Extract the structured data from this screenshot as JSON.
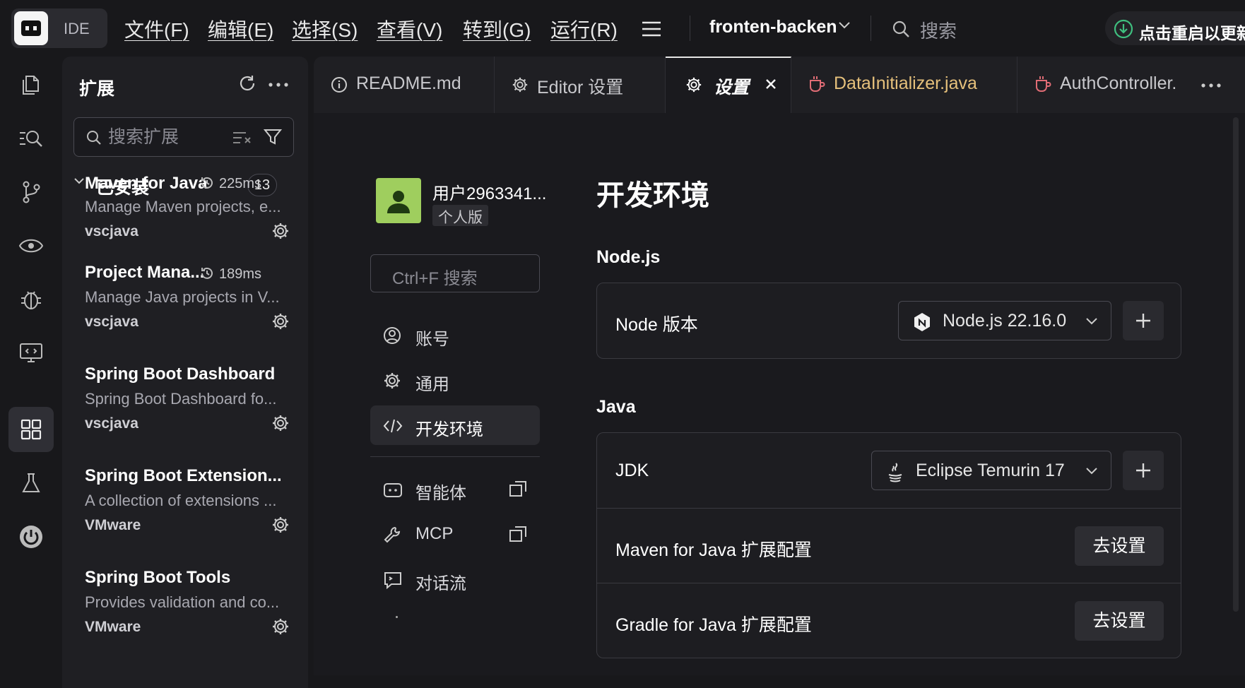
{
  "app": {
    "logo_text": "IDE"
  },
  "menu": [
    {
      "label": "文件(F)"
    },
    {
      "label": "编辑(E)"
    },
    {
      "label": "选择(S)"
    },
    {
      "label": "查看(V)"
    },
    {
      "label": "转到(G)"
    },
    {
      "label": "运行(R)"
    }
  ],
  "project": {
    "name": "fronten-backen"
  },
  "global_search": {
    "placeholder": "搜索"
  },
  "restart": {
    "label": "点击重启以更新"
  },
  "sidebar": {
    "title": "扩展",
    "search_placeholder": "搜索扩展",
    "installed_label": "已安装",
    "installed_count": "13",
    "extensions": [
      {
        "name": "Maven for Java",
        "time": "225ms",
        "desc": "Manage Maven projects, e...",
        "publisher": "vscjava"
      },
      {
        "name": "Project Mana...",
        "time": "189ms",
        "desc": "Manage Java projects in V...",
        "publisher": "vscjava"
      },
      {
        "name": "Spring Boot Dashboard",
        "time": "",
        "desc": "Spring Boot Dashboard fo...",
        "publisher": "vscjava"
      },
      {
        "name": "Spring Boot Extension...",
        "time": "",
        "desc": "A collection of extensions ...",
        "publisher": "VMware"
      },
      {
        "name": "Spring Boot Tools",
        "time": "",
        "desc": "Provides validation and co...",
        "publisher": "VMware"
      }
    ]
  },
  "tabs": [
    {
      "label": "README.md",
      "icon": "info-icon"
    },
    {
      "label": "Editor 设置",
      "icon": "gear-icon"
    },
    {
      "label": "设置",
      "icon": "gear-icon",
      "active": true
    },
    {
      "label": "DataInitializer.java",
      "icon": "java-cup-icon",
      "color": "#e5c07b"
    },
    {
      "label": "AuthController.",
      "icon": "java-cup-icon"
    }
  ],
  "settings": {
    "user": {
      "name": "用户2963341...",
      "plan": "个人版"
    },
    "search_placeholder": "Ctrl+F 搜索",
    "nav": [
      {
        "label": "账号"
      },
      {
        "label": "通用"
      },
      {
        "label": "开发环境"
      },
      {
        "label": "智能体"
      },
      {
        "label": "MCP"
      },
      {
        "label": "对话流"
      }
    ],
    "page_title": "开发环境",
    "nodejs": {
      "heading": "Node.js",
      "row_label": "Node 版本",
      "value": "Node.js 22.16.0"
    },
    "java": {
      "heading": "Java",
      "jdk_label": "JDK",
      "jdk_value": "Eclipse Temurin 17",
      "maven_label": "Maven for Java 扩展配置",
      "gradle_label": "Gradle for Java 扩展配置",
      "go_label": "去设置"
    }
  },
  "colors": {
    "accent_java_tab": "#e5c07b",
    "java_icon": "#e06c75",
    "avatar": "#9fce5e",
    "restart_icon": "#3fbf7f"
  }
}
